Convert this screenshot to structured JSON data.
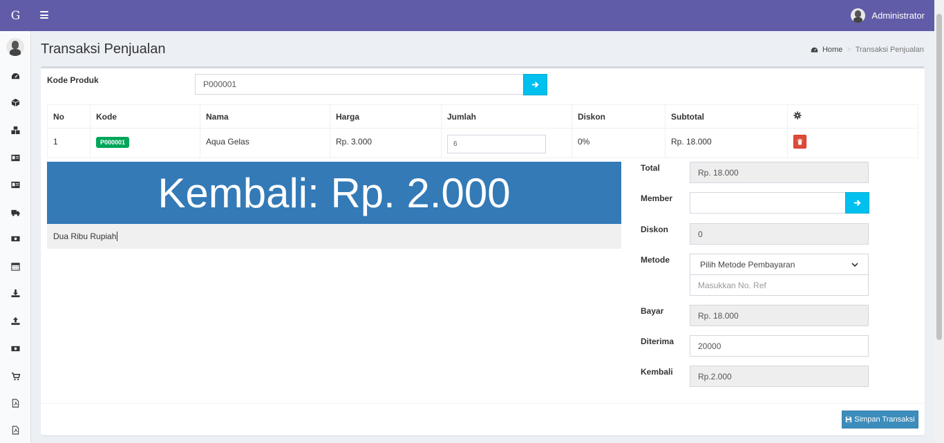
{
  "app": {
    "logo": "G"
  },
  "header": {
    "user_name": "Administrator"
  },
  "page": {
    "title": "Transaksi Penjualan",
    "breadcrumb": {
      "home": "Home",
      "current": "Transaksi Penjualan"
    }
  },
  "product_input": {
    "label": "Kode Produk",
    "value": "P000001"
  },
  "table": {
    "headers": [
      "No",
      "Kode",
      "Nama",
      "Harga",
      "Jumlah",
      "Diskon",
      "Subtotal"
    ],
    "rows": [
      {
        "no": "1",
        "kode": "P000001",
        "nama": "Aqua Gelas",
        "harga": "Rp. 3.000",
        "jumlah": "6",
        "diskon": "0%",
        "subtotal": "Rp. 18.000"
      }
    ]
  },
  "change_display": {
    "text": "Kembali: Rp. 2.000",
    "words": "Dua Ribu Rupiah"
  },
  "summary": {
    "total": {
      "label": "Total",
      "value": "Rp. 18.000"
    },
    "member": {
      "label": "Member",
      "value": ""
    },
    "diskon": {
      "label": "Diskon",
      "value": "0"
    },
    "metode": {
      "label": "Metode",
      "selected": "Pilih Metode Pembayaran",
      "ref_placeholder": "Masukkan No. Ref"
    },
    "bayar": {
      "label": "Bayar",
      "value": "Rp. 18.000"
    },
    "diterima": {
      "label": "Diterima",
      "value": "20000"
    },
    "kembali": {
      "label": "Kembali",
      "value": "Rp.2.000"
    }
  },
  "actions": {
    "save_label": "Simpan Transaksi"
  },
  "sidebar_icons": [
    "dashboard-icon",
    "cube-icon",
    "cubes-icon",
    "id-card-icon",
    "id-card-icon",
    "truck-icon",
    "money-icon",
    "calendar-icon",
    "download-icon",
    "upload-icon",
    "money-icon",
    "cart-icon",
    "pdf-icon",
    "pdf-icon"
  ],
  "colors": {
    "topbar": "#605ca8",
    "banner": "#337ab7",
    "info": "#00c0ef",
    "success": "#00a65a",
    "danger": "#dd4b39",
    "primary": "#3c8dbc"
  }
}
